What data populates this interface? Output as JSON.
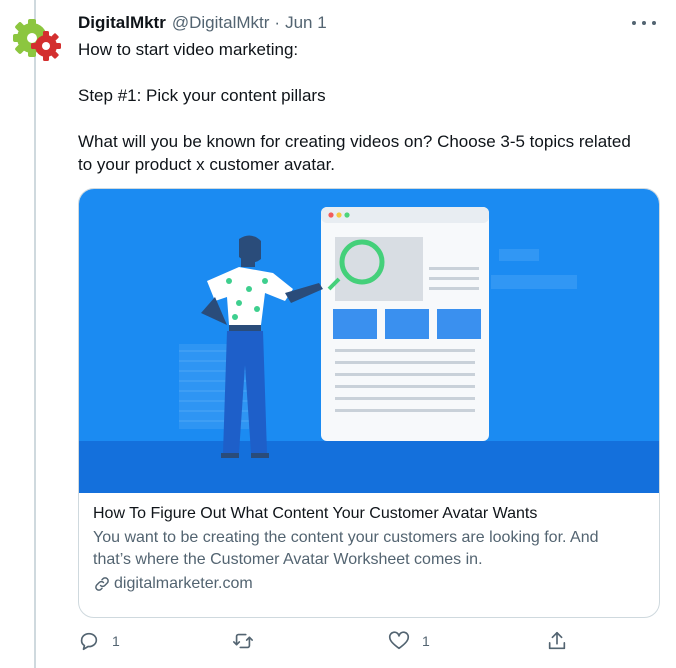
{
  "author": {
    "display_name": "DigitalMktr",
    "handle": "@DigitalMktr",
    "separator": "·",
    "date": "Jun 1"
  },
  "tweet": {
    "text": "How to start video marketing:\n\nStep #1: Pick your content pillars\n\nWhat will you be known for creating videos on? Choose 3-5 topics related\nto your product x customer avatar."
  },
  "link_card": {
    "title": "How To Figure Out What Content Your Customer Avatar Wants",
    "description": "You want to be creating the content your customers are looking for. And\nthat’s where the Customer Avatar Worksheet comes in.",
    "domain": "digitalmarketer.com"
  },
  "actions": {
    "reply_count": "1",
    "retweet_count": "",
    "like_count": "1"
  },
  "colors": {
    "text_primary": "#0f1419",
    "text_secondary": "#536471",
    "card_blue": "#1b8bf2",
    "border": "#cfd9de"
  },
  "icons": {
    "reply": "reply-icon",
    "retweet": "retweet-icon",
    "like": "heart-icon",
    "share": "share-icon",
    "more": "more-horizontal-icon",
    "link": "link-icon"
  }
}
